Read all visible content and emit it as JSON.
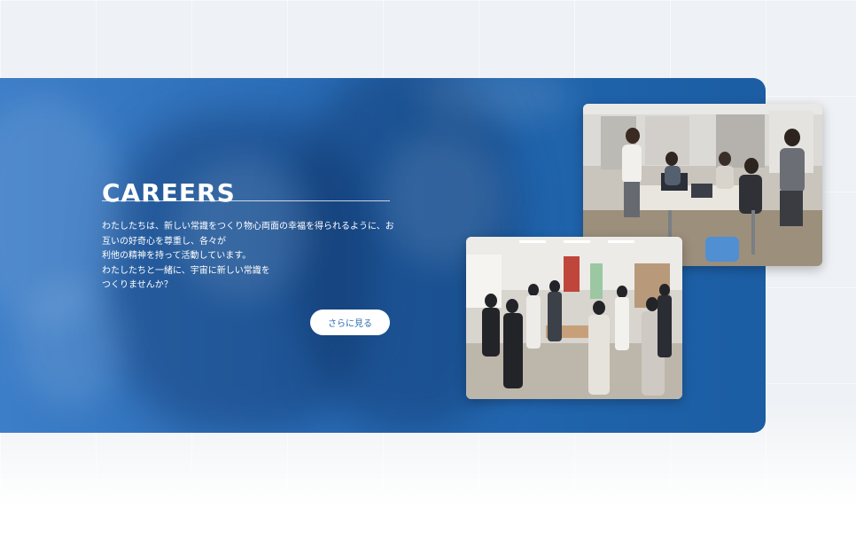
{
  "careers": {
    "title": "CAREERS",
    "body_lines": [
      "わたしたちは、新しい常識をつくり物心両面の幸福を得られるように、お",
      "互いの好奇心を尊重し、各々が",
      "利他の精神を持って活動しています。",
      "わたしたちと一緒に、宇宙に新しい常識を",
      "つくりませんか？"
    ],
    "button_label": "さらに見る"
  },
  "colors": {
    "panel_blue": "#2b6db7",
    "button_text": "#2a6db5",
    "background": "#eef1f5"
  }
}
